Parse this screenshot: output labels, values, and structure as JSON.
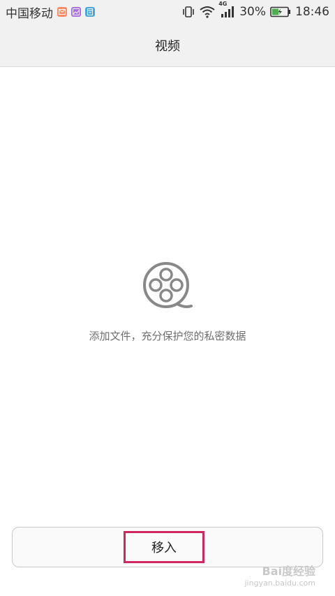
{
  "status_bar": {
    "carrier": "中国移动",
    "network_label": "4G",
    "battery_percent": "30%",
    "time": "18:46",
    "notification_icons": [
      "mail-icon",
      "gallery-icon",
      "calendar-icon"
    ],
    "notification_colors": [
      "#ff8a65",
      "#ab6fe0",
      "#4aa8e0"
    ]
  },
  "header": {
    "title": "视频"
  },
  "empty_state": {
    "icon": "film-reel-icon",
    "message": "添加文件，充分保护您的私密数据"
  },
  "footer": {
    "move_in_label": "移入",
    "highlight_color": "#d2275e"
  },
  "watermark": {
    "line1": "Bai度经验",
    "line2": "jingyan.baidu.com"
  }
}
